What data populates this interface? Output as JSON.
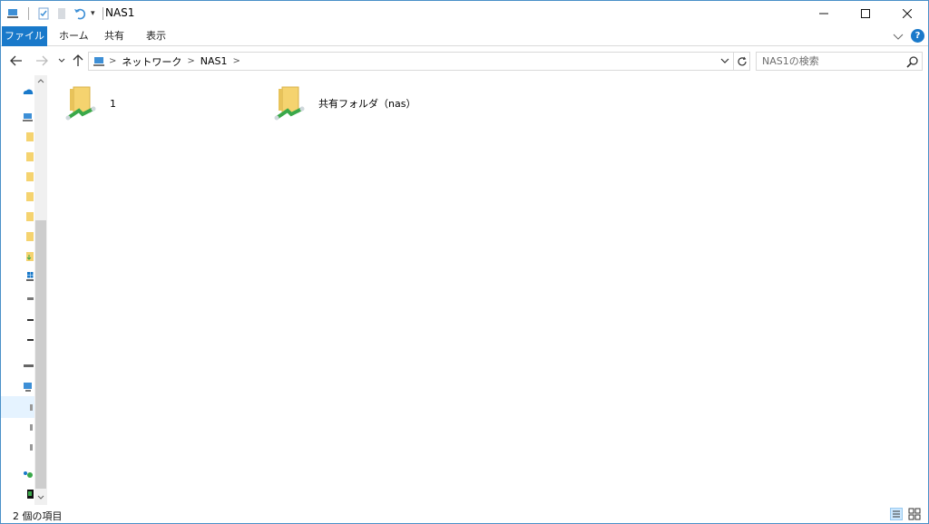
{
  "window": {
    "title": "NAS1"
  },
  "ribbon": {
    "tabs": [
      {
        "label": "ファイル"
      },
      {
        "label": "ホーム"
      },
      {
        "label": "共有"
      },
      {
        "label": "表示"
      }
    ]
  },
  "address": {
    "crumbs": [
      "ネットワーク",
      "NAS1"
    ]
  },
  "search": {
    "placeholder": "NAS1の検索"
  },
  "items": [
    {
      "label": "1",
      "icon": "shared-folder-icon"
    },
    {
      "label": "共有フォルダ（nas）",
      "icon": "shared-folder-icon"
    }
  ],
  "status": {
    "text": "2 個の項目"
  },
  "colors": {
    "accent": "#1979ca",
    "folder": "#f5d36f",
    "share": "#3aa84a"
  }
}
